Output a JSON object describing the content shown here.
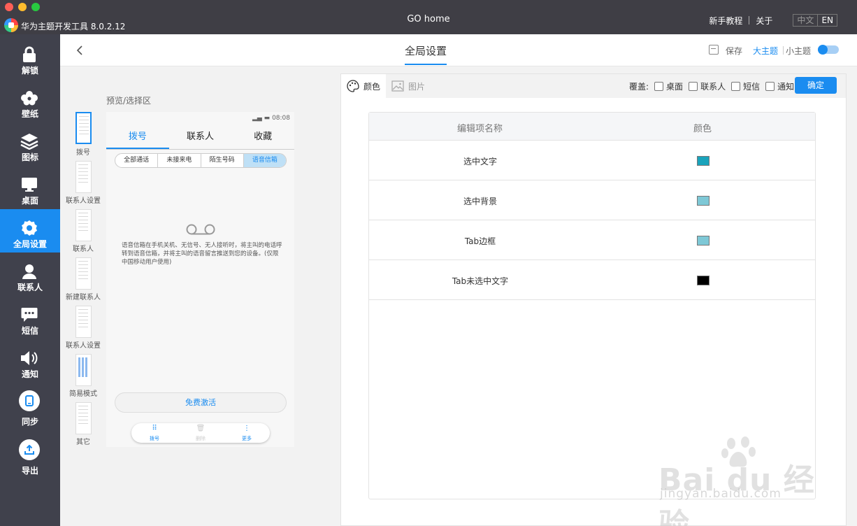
{
  "window": {
    "app_name": "华为主题开发工具 8.0.2.12",
    "title": "GO home",
    "links": {
      "tutorial": "新手教程",
      "about": "关于"
    },
    "lang": {
      "zh": "中文",
      "en": "EN"
    }
  },
  "sidebar": {
    "items": [
      {
        "label": "解锁",
        "icon": "lock-icon"
      },
      {
        "label": "壁纸",
        "icon": "flower-icon"
      },
      {
        "label": "图标",
        "icon": "layers-icon"
      },
      {
        "label": "桌面",
        "icon": "monitor-icon"
      },
      {
        "label": "全局设置",
        "icon": "gear-icon",
        "active": true
      },
      {
        "label": "联系人",
        "icon": "person-icon"
      },
      {
        "label": "短信",
        "icon": "chat-icon"
      },
      {
        "label": "通知",
        "icon": "speaker-icon"
      },
      {
        "label": "同步",
        "icon": "phone-icon"
      },
      {
        "label": "导出",
        "icon": "upload-icon"
      }
    ]
  },
  "header": {
    "title": "全局设置",
    "save": "保存",
    "big_theme": "大主题",
    "small_theme": "小主题"
  },
  "preview": {
    "title": "预览/选择区",
    "thumbnails": [
      "拨号",
      "联系人设置",
      "联系人",
      "新建联系人",
      "联系人设置",
      "简易模式",
      "其它"
    ],
    "phone": {
      "time": "08:08",
      "tabs": [
        "拨号",
        "联系人",
        "收藏"
      ],
      "segments": [
        "全部通话",
        "未接来电",
        "陌生号码",
        "语音信箱"
      ],
      "voicemail_text": "语音信箱在手机关机、无信号、无人接听时，将主叫的电话呼转到语音信箱，并将主叫的语音留言推送到您的设备。(仅限中国移动用户使用)",
      "activate": "免费激活",
      "dock": [
        "拨号",
        "删除",
        "更多"
      ]
    }
  },
  "editor": {
    "tabs": {
      "color": "颜色",
      "image": "图片"
    },
    "override_label": "覆盖:",
    "override_options": [
      "桌面",
      "联系人",
      "短信",
      "通知"
    ],
    "confirm": "确定",
    "columns": [
      "编辑项名称",
      "颜色"
    ],
    "rows": [
      {
        "name": "选中文字",
        "color": "#1aa3bb"
      },
      {
        "name": "选中背景",
        "color": "#7ec8d6"
      },
      {
        "name": "Tab边框",
        "color": "#7ec8d6"
      },
      {
        "name": "Tab未选中文字",
        "color": "#000000"
      }
    ]
  },
  "watermark": {
    "text": "Bai du 经验",
    "sub": "jingyan.baidu.com"
  }
}
